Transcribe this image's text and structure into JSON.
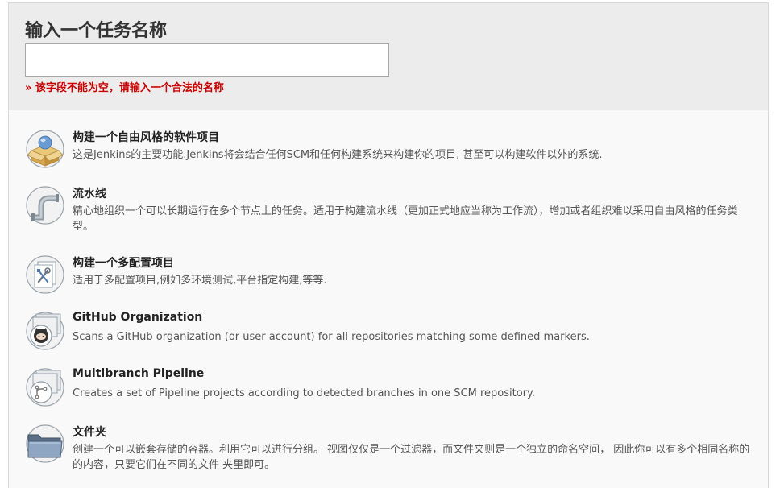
{
  "header": {
    "title": "输入一个任务名称",
    "name_input": {
      "value": "",
      "placeholder": ""
    },
    "error_message": "» 该字段不能为空，请输入一个合法的名称"
  },
  "items": [
    {
      "icon": "freestyle-package-icon",
      "title": "构建一个自由风格的软件项目",
      "description": "这是Jenkins的主要功能.Jenkins将会结合任何SCM和任何构建系统来构建你的项目, 甚至可以构建软件以外的系统."
    },
    {
      "icon": "pipeline-icon",
      "title": "流水线",
      "description": "精心地组织一个可以长期运行在多个节点上的任务。适用于构建流水线（更加正式地应当称为工作流），增加或者组织难以采用自由风格的任务类型。"
    },
    {
      "icon": "multi-config-icon",
      "title": "构建一个多配置项目",
      "description": "适用于多配置项目,例如多环境测试,平台指定构建,等等."
    },
    {
      "icon": "github-organization-icon",
      "title": "GitHub Organization",
      "description": "Scans a GitHub organization (or user account) for all repositories matching some defined markers."
    },
    {
      "icon": "multibranch-pipeline-icon",
      "title": "Multibranch Pipeline",
      "description": "Creates a set of Pipeline projects according to detected branches in one SCM repository."
    },
    {
      "icon": "folder-icon",
      "title": "文件夹",
      "description": "创建一个可以嵌套存储的容器。利用它可以进行分组。 视图仅仅是一个过滤器，而文件夹则是一个独立的命名空间， 因此你可以有多个相同名称的的内容，只要它们在不同的文件 夹里即可。"
    }
  ]
}
